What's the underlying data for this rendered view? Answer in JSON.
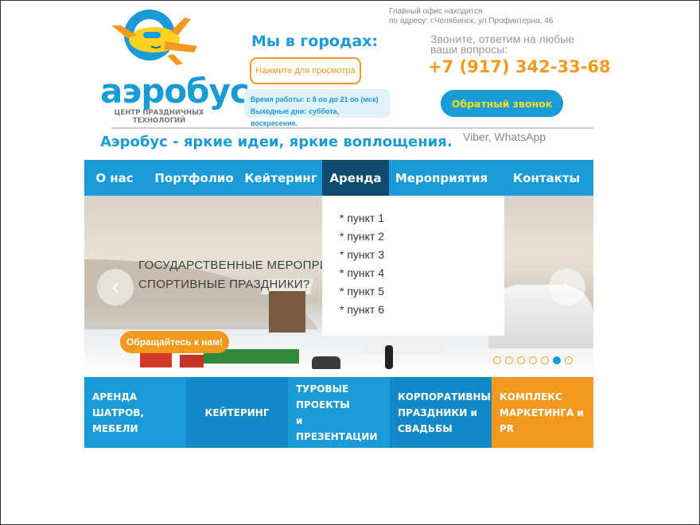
{
  "header": {
    "logo_word": "аэробус",
    "logo_subtitle": "ЦЕНТР ПРАЗДНИЧНЫХ ТЕХНОЛОГИЙ",
    "cities_title": "Мы в городах:",
    "view_button": "Нажмите для просмотра",
    "hours_line1": "Время работы: с 8 оо до 21 оо (мск)",
    "hours_line2": "Выходные дни: суббота, воскресение.",
    "office_line1": "Главный офис находится",
    "office_line2": "по адресу: г.Челябинск, ул.Профинтерна, 46",
    "call_line1": "Звоните, ответим на любые",
    "call_line2": "ваши вопросы:",
    "phone": "+7 (917) 342-33-68",
    "callback_button": "Обратный звонок",
    "tagline": "Аэробус - яркие идеи, яркие воплощения.",
    "messengers": "Viber, WhatsApp"
  },
  "nav": {
    "items": [
      {
        "label": "О нас"
      },
      {
        "label": "Портфолио"
      },
      {
        "label": "Кейтеринг"
      },
      {
        "label": "Аренда"
      },
      {
        "label": "Мероприятия"
      },
      {
        "label": "Контакты"
      }
    ],
    "active": "Аренда"
  },
  "dropdown": {
    "items": [
      "* пункт 1",
      "* пункт 2",
      "* пункт 3",
      "* пункт 4",
      "* пункт 5",
      "* пункт 6"
    ]
  },
  "slider": {
    "line1": "ГОСУДАРСТВЕННЫЕ МЕРОПРИЯТИ",
    "line2": "СПОРТИВНЫЕ ПРАЗДНИКИ?",
    "cta": "Обращайтесь к нам!",
    "prev_icon": "chevron-left-icon",
    "next_icon": "chevron-right-icon",
    "dot_count": 7,
    "active_dot": 5
  },
  "tiles": [
    {
      "line1": "АРЕНДА ШАТРОВ,",
      "line2": "МЕБЕЛИ",
      "color": "#1a9ad7"
    },
    {
      "line1": "КЕЙТЕРИНГ",
      "line2": "",
      "color": "#1189c8"
    },
    {
      "line1": "ТУРОВЫЕ ПРОЕКТЫ",
      "line2": "и ПРЕЗЕНТАЦИИ",
      "color": "#1a9ad7"
    },
    {
      "line1": "КОРПОРАТИВНЫЕ",
      "line2": "ПРАЗДНИКИ и",
      "line3": "СВАДЬБЫ",
      "color": "#1189c8"
    },
    {
      "line1": "КОМПЛЕКС",
      "line2": "МАРКЕТИНГА и PR",
      "color": "#f39a1e"
    }
  ],
  "colors": {
    "brand_blue": "#1a9ad7",
    "brand_orange": "#f39a1e",
    "nav_active": "#0d4a6e"
  }
}
